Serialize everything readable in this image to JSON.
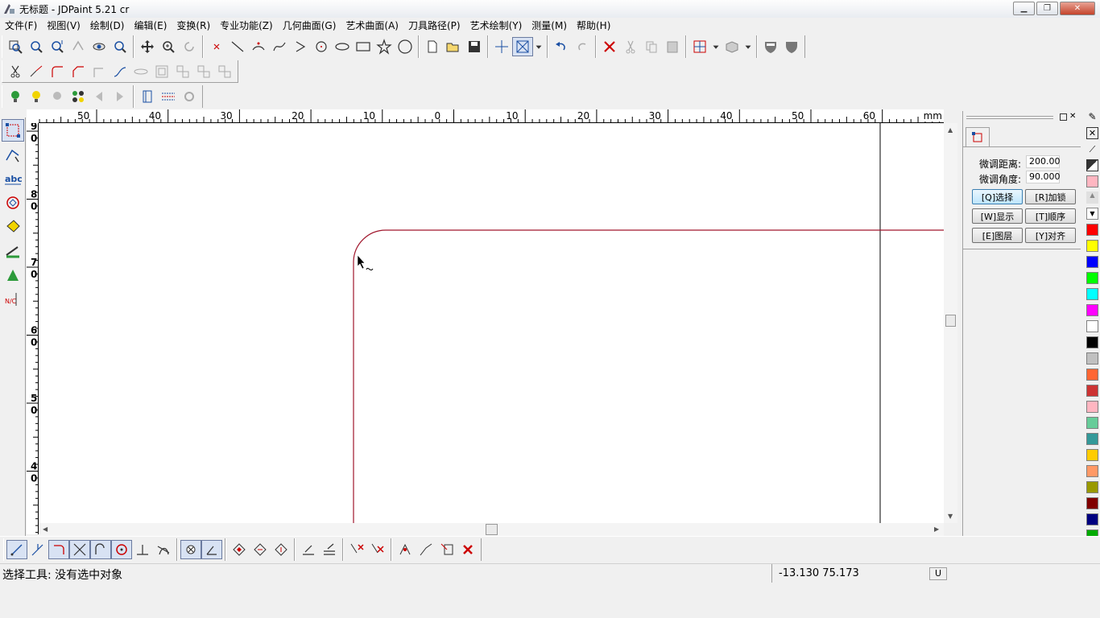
{
  "window": {
    "title": "无标题 - JDPaint 5.21 cr"
  },
  "menu": [
    "文件(F)",
    "视图(V)",
    "绘制(D)",
    "编辑(E)",
    "变换(R)",
    "专业功能(Z)",
    "几何曲面(G)",
    "艺术曲面(A)",
    "刀具路径(P)",
    "艺术绘制(Y)",
    "测量(M)",
    "帮助(H)"
  ],
  "ruler": {
    "unit": "mm",
    "h_labels": [
      "50",
      "40",
      "30",
      "20",
      "10",
      "0",
      "10",
      "20",
      "30",
      "40",
      "50",
      "60"
    ],
    "v_labels": [
      "9\n0",
      "8\n0",
      "7\n0",
      "6\n0",
      "5\n0",
      "4\n0"
    ]
  },
  "panel": {
    "fine_distance_label": "微调距离:",
    "fine_distance_value": "200.00",
    "fine_angle_label": "微调角度:",
    "fine_angle_value": "90.000",
    "btn_select": "[Q]选择",
    "btn_lock": "[R]加锁",
    "btn_show": "[W]显示",
    "btn_order": "[T]顺序",
    "btn_layer": "[E]图层",
    "btn_align": "[Y]对齐"
  },
  "palette": [
    "#ffb6c1",
    "#e0e0e0",
    "#ffffff",
    "#ff0000",
    "#ffff00",
    "#0000ff",
    "#00ff00",
    "#00ffff",
    "#ff00ff",
    "#ffffff",
    "#000000",
    "#c0c0c0",
    "#ff6633",
    "#cc3333",
    "#ffb6c1",
    "#66cc99",
    "#339999",
    "#ffcc00",
    "#ff9966",
    "#999900",
    "#800000",
    "#000080",
    "#00aa00"
  ],
  "status": {
    "message": "选择工具: 没有选中对象",
    "coords": "-13.130  75.173",
    "mode": "U"
  }
}
